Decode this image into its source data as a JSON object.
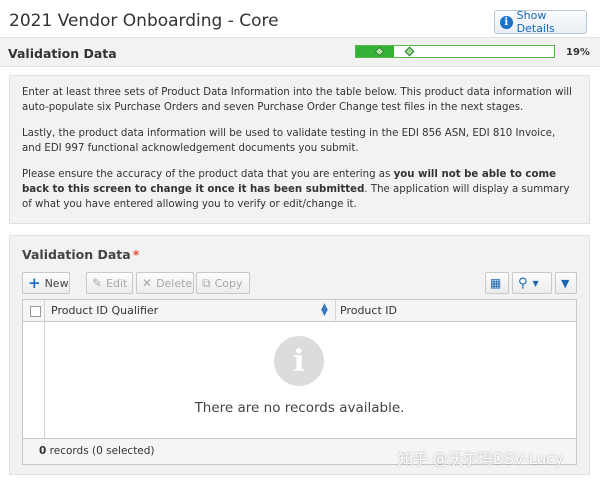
{
  "header": {
    "title": "2021 Vendor Onboarding - Core",
    "show_details_label": "Show Details"
  },
  "progress": {
    "title": "Validation Data",
    "percent_label": "19%",
    "value": 0.19
  },
  "info": {
    "p1": "Enter at least three sets of Product Data Information into the table below. This product data information will auto-populate six Purchase Orders and seven Purchase Order Change test files in the next stages.",
    "p2": "Lastly, the product data information will be used to validate testing in the EDI 856 ASN, EDI 810 Invoice, and EDI 997 functional acknowledgement documents you submit.",
    "p3_pre": "Please ensure the accuracy of the product data that you are entering as ",
    "p3_bold": "you will not be able to come back to this screen to change it once it has been submitted",
    "p3_post": ". The application will display a summary of what you have entered allowing you to verify or edit/change it."
  },
  "panel": {
    "title": "Validation Data",
    "required_mark": "*"
  },
  "toolbar": {
    "new_label": "New",
    "edit_label": "Edit",
    "delete_label": "Delete",
    "copy_label": "Copy"
  },
  "grid": {
    "columns": [
      "Product ID Qualifier",
      "Product ID"
    ],
    "empty_message": "There are no records available.",
    "footer_count": "0",
    "footer_text": " records (0 selected)"
  },
  "watermark": "知乎 @沃尔玛DSV-Lucy",
  "colors": {
    "accent": "#1a73c8",
    "progress_green": "#35b235",
    "required": "#e34b3a"
  }
}
